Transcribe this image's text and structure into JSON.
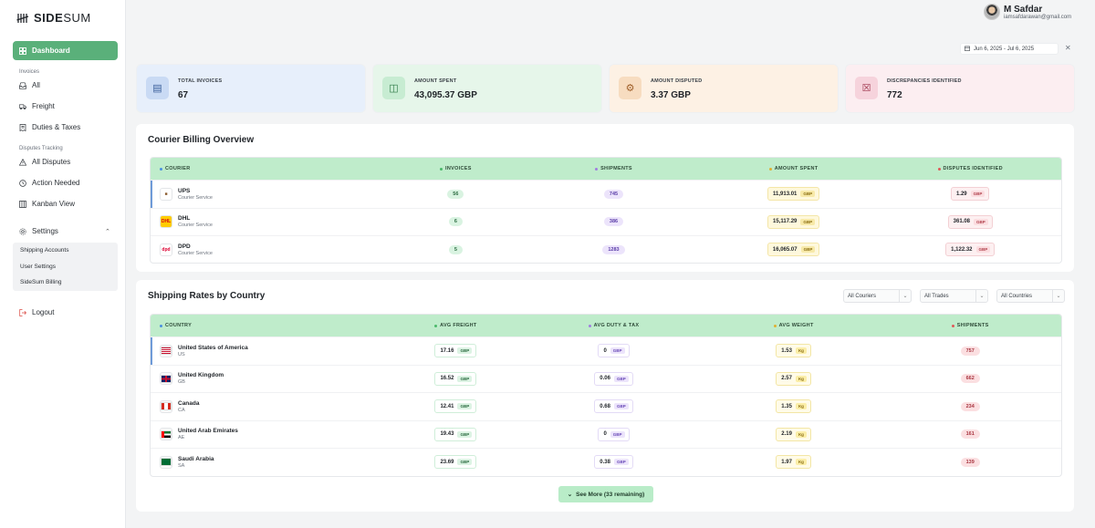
{
  "brand": {
    "name_bold": "SIDE",
    "name_light": "SUM"
  },
  "user": {
    "name": "M Safdar",
    "email": "iamsafdarawan@gmail.com"
  },
  "date_range": "Jun 6, 2025 - Jul 6, 2025",
  "sidebar": {
    "dashboard": "Dashboard",
    "invoices_label": "Invoices",
    "invoices": [
      "All",
      "Freight",
      "Duties & Taxes"
    ],
    "disputes_label": "Disputes Tracking",
    "disputes": [
      "All Disputes",
      "Action Needed",
      "Kanban View"
    ],
    "settings": "Settings",
    "settings_items": [
      "Shipping Accounts",
      "User Settings",
      "SideSum Billing"
    ],
    "logout": "Logout"
  },
  "stats": [
    {
      "label": "TOTAL INVOICES",
      "value": "67",
      "bg": "#e7effb",
      "icon_bg": "#c9daf4",
      "icon": "invoice-icon"
    },
    {
      "label": "AMOUNT SPENT",
      "value": "43,095.37 GBP",
      "bg": "#e6f6ea",
      "icon_bg": "#c7ecd2",
      "icon": "money-icon"
    },
    {
      "label": "AMOUNT DISPUTED",
      "value": "3.37 GBP",
      "bg": "#fdf1e4",
      "icon_bg": "#f7dcc0",
      "icon": "dispute-money-icon"
    },
    {
      "label": "DISCREPANCIES IDENTIFIED",
      "value": "772",
      "bg": "#fceef1",
      "icon_bg": "#f6d3dc",
      "icon": "discrepancy-file-icon"
    }
  ],
  "courier_panel": {
    "title": "Courier Billing Overview",
    "headers": [
      "COURIER",
      "INVOICES",
      "SHIPMENTS",
      "AMOUNT SPENT",
      "DISPUTES IDENTIFIED"
    ],
    "rows": [
      {
        "name": "UPS",
        "sub": "Courier Service",
        "invoices": "56",
        "shipments": "745",
        "amount": "11,913.01",
        "disputes": "1.29"
      },
      {
        "name": "DHL",
        "sub": "Courier Service",
        "invoices": "6",
        "shipments": "386",
        "amount": "15,117.29",
        "disputes": "361.08"
      },
      {
        "name": "DPD",
        "sub": "Courier Service",
        "invoices": "5",
        "shipments": "1283",
        "amount": "16,065.07",
        "disputes": "1,122.32"
      }
    ],
    "currency": "GBP"
  },
  "country_panel": {
    "title": "Shipping Rates by Country",
    "filters": [
      "All Couriers",
      "All Trades",
      "All Countries"
    ],
    "headers": [
      "COUNTRY",
      "AVG FREIGHT",
      "AVG DUTY & TAX",
      "AVG WEIGHT",
      "SHIPMENTS"
    ],
    "rows": [
      {
        "name": "United States of America",
        "code": "US",
        "freight": "17.16",
        "duty": "0",
        "weight": "1.53",
        "shipments": "757"
      },
      {
        "name": "United Kingdom",
        "code": "GB",
        "freight": "16.52",
        "duty": "0.06",
        "weight": "2.57",
        "shipments": "662"
      },
      {
        "name": "Canada",
        "code": "CA",
        "freight": "12.41",
        "duty": "0.68",
        "weight": "1.35",
        "shipments": "234"
      },
      {
        "name": "United Arab Emirates",
        "code": "AE",
        "freight": "19.43",
        "duty": "0",
        "weight": "2.19",
        "shipments": "161"
      },
      {
        "name": "Saudi Arabia",
        "code": "SA",
        "freight": "23.69",
        "duty": "0.38",
        "weight": "1.97",
        "shipments": "139"
      }
    ],
    "currency": "GBP",
    "weight_unit": "Kg",
    "see_more": "See More (33 remaining)"
  },
  "colors": {
    "accent": "#5ab07a",
    "header_green": "#bfeccb"
  }
}
